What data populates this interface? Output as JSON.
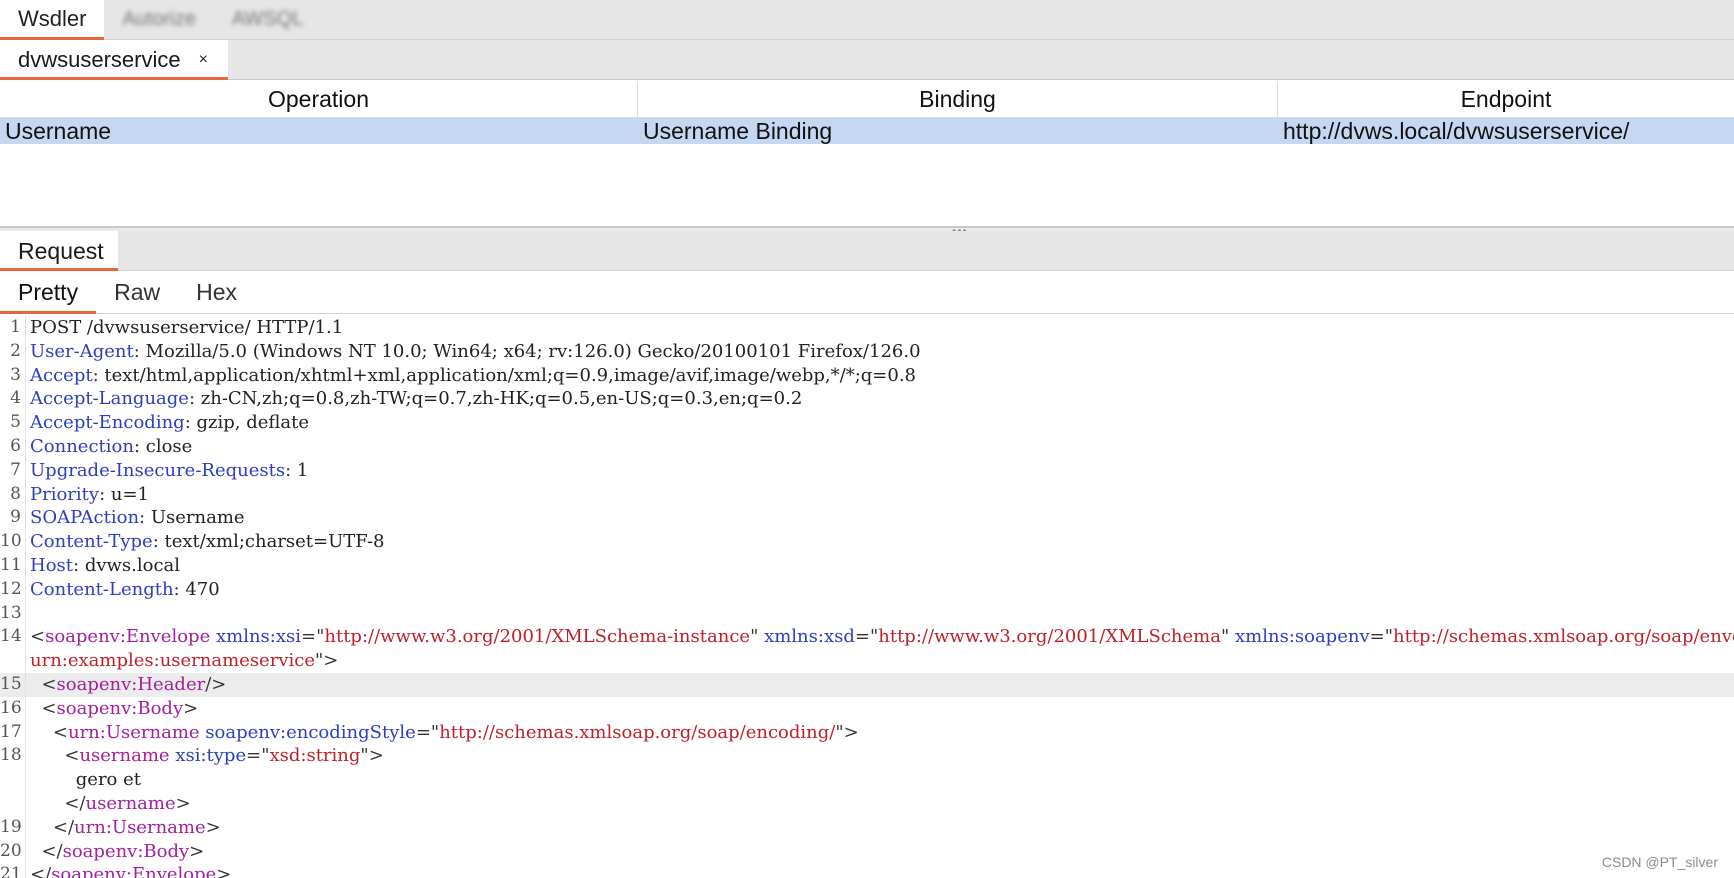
{
  "top_tabs": [
    {
      "label": "Wsdler",
      "active": true
    },
    {
      "label": "Autorize",
      "blurred": true
    },
    {
      "label": "AWSQL",
      "blurred": true
    }
  ],
  "service_tab": {
    "label": "dvwsuserservice",
    "close": "×"
  },
  "table": {
    "headers": [
      "Operation",
      "Binding",
      "Endpoint"
    ],
    "rows": [
      {
        "operation": "Username",
        "binding": "Username Binding",
        "endpoint": "http://dvws.local/dvwsuserservice/"
      }
    ]
  },
  "splitter_grip": "•••",
  "request_tab": "Request",
  "view_tabs": [
    "Pretty",
    "Raw",
    "Hex"
  ],
  "editor": {
    "line_numbers": [
      "1",
      "2",
      "3",
      "4",
      "5",
      "6",
      "7",
      "8",
      "9",
      "10",
      "11",
      "12",
      "13",
      "14",
      "",
      "15",
      "16",
      "17",
      "18",
      "",
      "",
      "19",
      "20",
      "21"
    ],
    "l1": "POST /dvwsuserservice/ HTTP/1.1",
    "headers": [
      {
        "name": "User-Agent",
        "value": " Mozilla/5.0 (Windows NT 10.0; Win64; x64; rv:126.0) Gecko/20100101 Firefox/126.0"
      },
      {
        "name": "Accept",
        "value": " text/html,application/xhtml+xml,application/xml;q=0.9,image/avif,image/webp,*/*;q=0.8"
      },
      {
        "name": "Accept-Language",
        "value": " zh-CN,zh;q=0.8,zh-TW;q=0.7,zh-HK;q=0.5,en-US;q=0.3,en;q=0.2"
      },
      {
        "name": "Accept-Encoding",
        "value": " gzip, deflate"
      },
      {
        "name": "Connection",
        "value": " close"
      },
      {
        "name": "Upgrade-Insecure-Requests",
        "value": " 1"
      },
      {
        "name": "Priority",
        "value": " u=1"
      },
      {
        "name": "SOAPAction",
        "value": " Username"
      },
      {
        "name": "Content-Type",
        "value": " text/xml;charset=UTF-8"
      },
      {
        "name": "Host",
        "value": " dvws.local"
      },
      {
        "name": "Content-Length",
        "value": " 470"
      }
    ],
    "xml": {
      "envelope_tag": "soapenv:Envelope",
      "xsi_attr": "xmlns:xsi",
      "xsi_val": "http://www.w3.org/2001/XMLSchema-instance",
      "xsd_attr": "xmlns:xsd",
      "xsd_val": "http://www.w3.org/2001/XMLSchema",
      "soapenv_attr": "xmlns:soapenv",
      "soapenv_val": "http://schemas.xmlsoap.org/soap/envelope/",
      "urn_cont": "urn:examples:usernameservice",
      "header_tag": "soapenv:Header",
      "body_tag": "soapenv:Body",
      "username_op_tag": "urn:Username",
      "encoding_attr": "soapenv:encodingStyle",
      "encoding_val": "http://schemas.xmlsoap.org/soap/encoding/",
      "username_tag": "username",
      "type_attr": "xsi:type",
      "type_val": "xsd:string",
      "username_value": "gero et"
    }
  },
  "watermark": "CSDN @PT_silver",
  "colors": {
    "accent": "#e8673a",
    "selected_row": "#c6d8f1",
    "header_key": "#2b3fbf",
    "xml_tag": "#a21fa0",
    "xml_string": "#c01f2a"
  }
}
